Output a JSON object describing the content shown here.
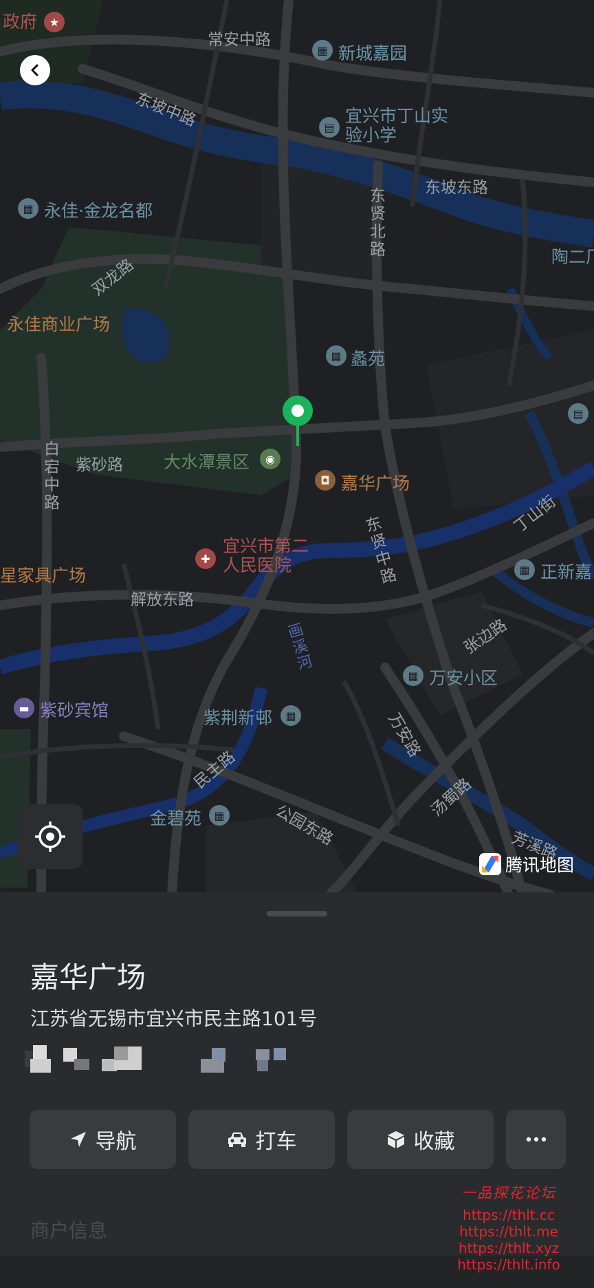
{
  "map": {
    "roads": [
      "常安中路",
      "东坡中路",
      "东坡东路",
      "东贤北路",
      "双龙路",
      "紫砂路",
      "白宕中路",
      "解放东路",
      "东贤中路",
      "丁山街",
      "张边路",
      "民主路",
      "公园东路",
      "万安路",
      "汤蜀路",
      "芳溪路"
    ],
    "pois": {
      "top_left": "政府",
      "xincheng": "新城嘉园",
      "school": "宜兴市丁山实验小学",
      "yongjia_jinlong": "永佳·金龙名都",
      "yongjia_mall": "永佳商业广场",
      "taoer": "陶二厂",
      "liyuan": "蠡苑",
      "dashuitan": "大水潭景区",
      "jiahua": "嘉华广场",
      "furniture": "星家具广场",
      "hospital_l1": "宜兴市第二",
      "hospital_l2": "人民医院",
      "zhengxin": "正新嘉",
      "wanan": "万安小区",
      "hotel": "紫砂宾馆",
      "zijing": "紫荆新邨",
      "jinbi": "金碧苑"
    },
    "water": "画溪河",
    "logo_text": "腾讯地图"
  },
  "place": {
    "title": "嘉华广场",
    "address": "江苏省无锡市宜兴市民主路101号"
  },
  "actions": {
    "navigate": "导航",
    "taxi": "打车",
    "favorite": "收藏"
  },
  "sheet_faded_label": "商户信息",
  "watermark": {
    "title": "一品探花论坛",
    "urls": [
      "https://thlt.cc",
      "https://thlt.me",
      "https://thlt.xyz",
      "https://thlt.info"
    ]
  },
  "colors": {
    "pin": "#1bb35a",
    "map_bg": "#1f2023",
    "water": "#16305a",
    "sheet": "#2a2b2e"
  }
}
